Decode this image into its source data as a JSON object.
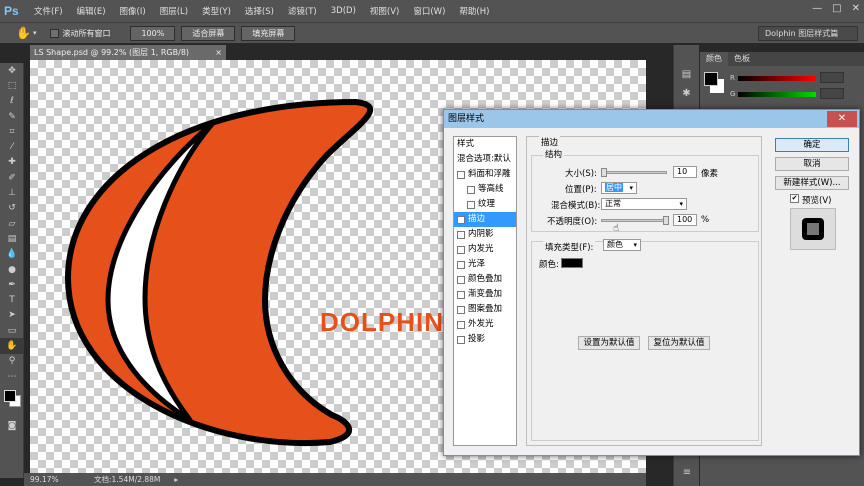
{
  "app": {
    "logo": "Ps",
    "menus": [
      "文件(F)",
      "编辑(E)",
      "图像(I)",
      "图层(L)",
      "类型(Y)",
      "选择(S)",
      "滤镜(T)",
      "3D(D)",
      "视图(V)",
      "窗口(W)",
      "帮助(H)"
    ],
    "window_controls": [
      "—",
      "□",
      "✕"
    ]
  },
  "options": {
    "scroll_all": "滚动所有窗口",
    "zoom_100": "100%",
    "fit_screen": "适合屏幕",
    "fill_screen": "填充屏幕",
    "workspace": "Dolphin 图层样式篇"
  },
  "document": {
    "tab": "LS Shape.psd @ 99.2% (图层 1, RGB/8)",
    "canvas_text": "DOLPHIN",
    "zoom": "99.17%",
    "doc_size": "文档:1.54M/2.88M"
  },
  "color_panel": {
    "tab_color": "颜色",
    "tab_swatch": "色板",
    "r_label": "R",
    "g_label": "G"
  },
  "dialog": {
    "title": "图层样式",
    "styles_header": "样式",
    "blend_default": "混合选项:默认",
    "effects": [
      {
        "label": "斜面和浮雕",
        "checked": false,
        "indent": 0
      },
      {
        "label": "等高线",
        "checked": false,
        "indent": 1
      },
      {
        "label": "纹理",
        "checked": false,
        "indent": 1
      },
      {
        "label": "描边",
        "checked": true,
        "indent": 0,
        "selected": true
      },
      {
        "label": "内阴影",
        "checked": false,
        "indent": 0
      },
      {
        "label": "内发光",
        "checked": false,
        "indent": 0
      },
      {
        "label": "光泽",
        "checked": false,
        "indent": 0
      },
      {
        "label": "颜色叠加",
        "checked": false,
        "indent": 0
      },
      {
        "label": "渐变叠加",
        "checked": false,
        "indent": 0
      },
      {
        "label": "图案叠加",
        "checked": false,
        "indent": 0
      },
      {
        "label": "外发光",
        "checked": false,
        "indent": 0
      },
      {
        "label": "投影",
        "checked": false,
        "indent": 0
      }
    ],
    "stroke_title": "描边",
    "structure": "结构",
    "size_label": "大小(S):",
    "size_value": "10",
    "size_unit": "像素",
    "position_label": "位置(P):",
    "position_value": "居中",
    "blend_label": "混合模式(B):",
    "blend_value": "正常",
    "opacity_label": "不透明度(O):",
    "opacity_value": "100",
    "opacity_unit": "%",
    "fill_type_label": "填充类型(F):",
    "fill_type_value": "颜色",
    "color_label": "颜色:",
    "set_default": "设置为默认值",
    "reset_default": "复位为默认值",
    "ok": "确定",
    "cancel": "取消",
    "new_style": "新建样式(W)...",
    "preview": "预览(V)"
  },
  "colors": {
    "shape_orange": "#e5501b",
    "stroke_black": "#000000",
    "ui_dark": "#535353"
  }
}
